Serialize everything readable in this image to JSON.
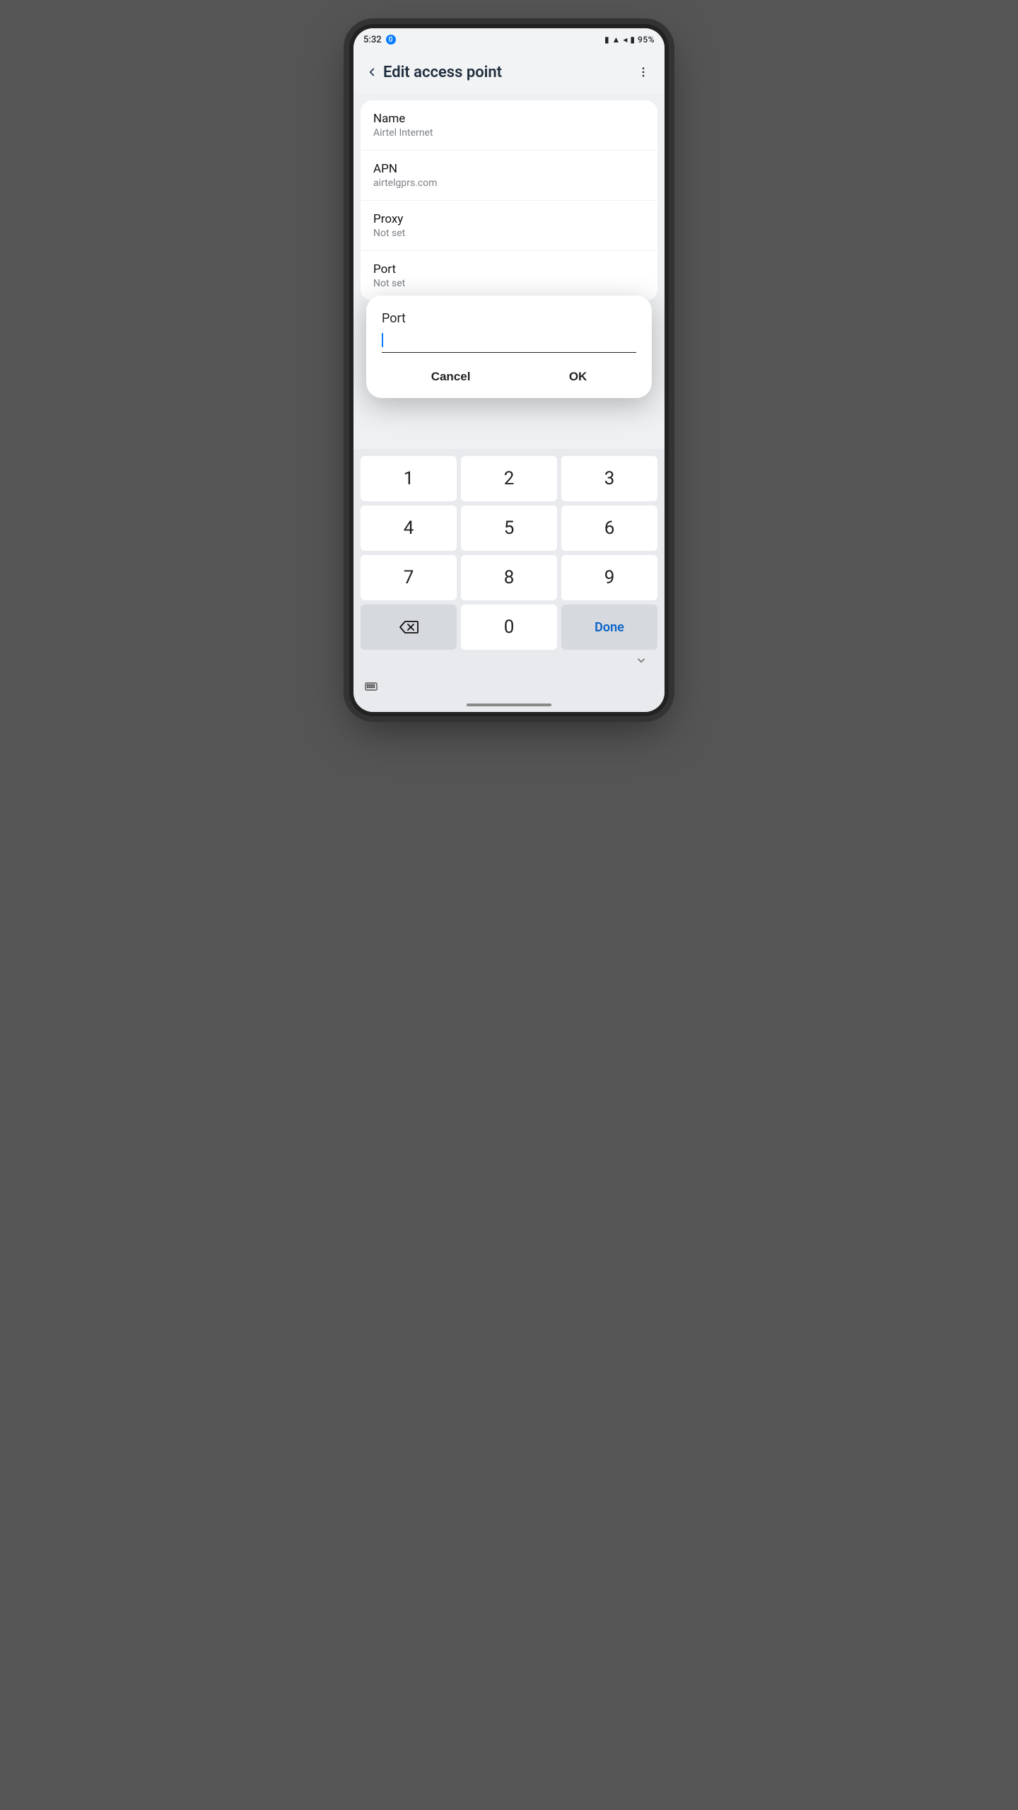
{
  "statusbar": {
    "time": "5:32",
    "battery": "95%"
  },
  "header": {
    "title": "Edit access point"
  },
  "settings": [
    {
      "label": "Name",
      "value": "Airtel Internet"
    },
    {
      "label": "APN",
      "value": "airtelgprs.com"
    },
    {
      "label": "Proxy",
      "value": "Not set"
    },
    {
      "label": "Port",
      "value": "Not set"
    }
  ],
  "dialog": {
    "label": "Port",
    "value": "",
    "cancel": "Cancel",
    "ok": "OK"
  },
  "keypad": {
    "keys": [
      "1",
      "2",
      "3",
      "4",
      "5",
      "6",
      "7",
      "8",
      "9"
    ],
    "zero": "0",
    "done": "Done"
  }
}
